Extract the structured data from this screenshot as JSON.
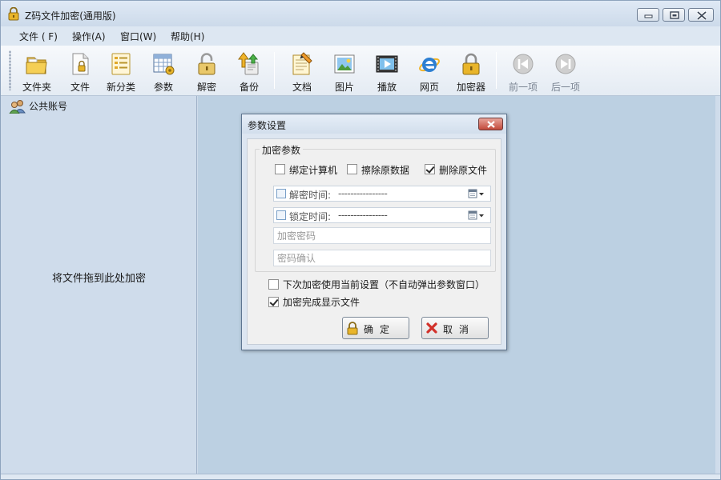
{
  "window": {
    "title": "Z码文件加密(通用版)"
  },
  "menu": [
    "文件 ( F)",
    "操作(A)",
    "窗口(W)",
    "帮助(H)"
  ],
  "toolbar": {
    "folder": "文件夹",
    "file": "文件",
    "new_category": "新分类",
    "params": "参数",
    "decrypt": "解密",
    "backup": "备份",
    "document": "文档",
    "picture": "图片",
    "play": "播放",
    "webpage": "网页",
    "encryptor": "加密器",
    "prev": "前一项",
    "next": "后一项"
  },
  "left_panel": {
    "account": "公共账号",
    "drop_hint": "将文件拖到此处加密"
  },
  "dialog": {
    "title": "参数设置",
    "group_title": "加密参数",
    "bind_computer": {
      "label": "绑定计算机",
      "checked": false
    },
    "wipe_original": {
      "label": "擦除原数据",
      "checked": false
    },
    "delete_original": {
      "label": "删除原文件",
      "checked": true
    },
    "decrypt_time": {
      "label": "解密时间:",
      "value": "----------------"
    },
    "lock_time": {
      "label": "锁定时间:",
      "value": "----------------"
    },
    "password_placeholder": "加密密码",
    "confirm_placeholder": "密码确认",
    "use_current": {
      "label": "下次加密使用当前设置（不自动弹出参数窗口）",
      "checked": false
    },
    "show_file": {
      "label": "加密完成显示文件",
      "checked": true
    },
    "ok": "确定",
    "cancel": "取消"
  },
  "colors": {
    "window_bg": "#cfdceb",
    "work_area": "#bcd0e2",
    "dialog_bg": "#f0f0f0",
    "close_red": "#c2493a"
  },
  "icons": {
    "title": "lock-icon",
    "account": "users-icon"
  }
}
